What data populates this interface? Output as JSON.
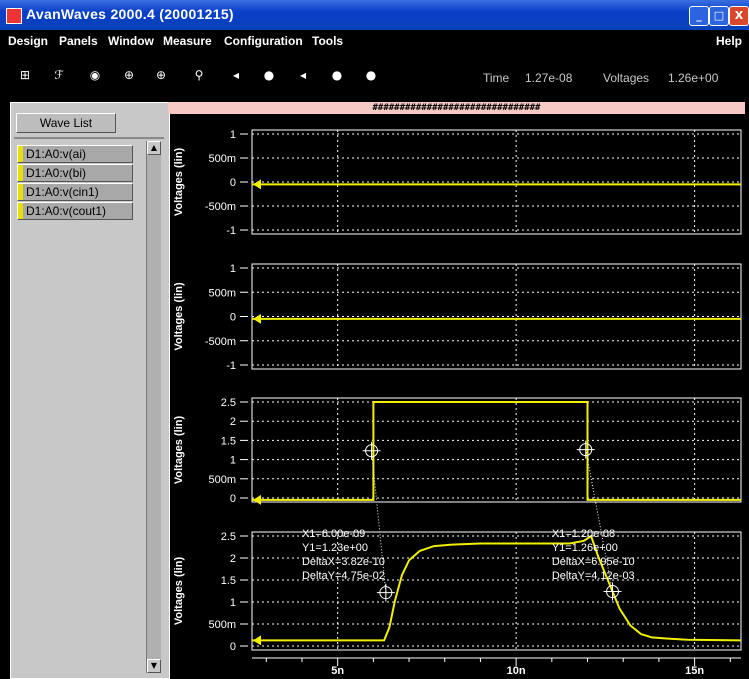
{
  "window": {
    "title": "AvanWaves 2000.4  (20001215)",
    "buttons": [
      "_",
      "□",
      "X"
    ]
  },
  "menu": {
    "items": [
      "Design",
      "Panels",
      "Window",
      "Measure",
      "Configuration",
      "Tools"
    ],
    "help": "Help"
  },
  "toolbar": {
    "icons": [
      "hierarchy-icon",
      "signal-split-icon",
      "cursor-eye-icon",
      "axis-add-icon",
      "zoom-add-icon",
      "magnify-icon",
      "pan-right-icon",
      "zoom-in-icon",
      "pan-left-icon",
      "zoom-out-icon",
      "zoom-fit-icon"
    ],
    "time_label": "Time",
    "time_value": "1.27e-08",
    "voltages_label": "Voltages",
    "voltages_value": "1.26e+00"
  },
  "panel": {
    "wave_list_label": "Wave List",
    "items": [
      "D1:A0:v(ai)",
      "D1:A0:v(bi)",
      "D1:A0:v(cin1)",
      "D1:A0:v(cout1)"
    ],
    "mark_color": "#e8e000"
  },
  "hatch_text": "###############################",
  "chart_data": [
    {
      "type": "line",
      "ylabel": "Voltages (lin)",
      "yticks": [
        "1",
        "500m",
        "0",
        "-500m",
        "-1"
      ],
      "ylim": [
        -1,
        1
      ],
      "series": [
        {
          "x": [
            2.6,
            16.3
          ],
          "y": [
            -0.05,
            -0.05
          ]
        }
      ]
    },
    {
      "type": "line",
      "ylabel": "Voltages (lin)",
      "yticks": [
        "1",
        "500m",
        "0",
        "-500m",
        "-1"
      ],
      "ylim": [
        -1,
        1
      ],
      "series": [
        {
          "x": [
            2.6,
            16.3
          ],
          "y": [
            -0.05,
            -0.05
          ]
        }
      ]
    },
    {
      "type": "line",
      "ylabel": "Voltages (lin)",
      "yticks": [
        "2.5",
        "2",
        "1.5",
        "1",
        "500m",
        "0"
      ],
      "ylim": [
        0,
        2.5
      ],
      "series": [
        {
          "x": [
            2.6,
            6.0,
            6.0,
            12.0,
            12.0,
            16.3
          ],
          "y": [
            -0.05,
            -0.05,
            2.5,
            2.5,
            -0.05,
            -0.05
          ]
        }
      ],
      "markers": [
        {
          "x": 5.95,
          "y": 1.23
        },
        {
          "x": 11.95,
          "y": 1.26
        }
      ]
    },
    {
      "type": "line",
      "ylabel": "Voltages (lin)",
      "yticks": [
        "2.5",
        "2",
        "1.5",
        "1",
        "500m",
        "0"
      ],
      "ylim": [
        -0.2,
        2.75
      ],
      "xticks": [
        "5n",
        "10n",
        "15n"
      ],
      "xtick_values": [
        5,
        10,
        15
      ],
      "xlim": [
        2.6,
        16.3
      ],
      "series": [
        {
          "x": [
            2.6,
            6.3,
            6.45,
            6.6,
            6.8,
            7.0,
            7.3,
            7.7,
            8.2,
            9.0,
            11.5,
            11.9,
            12.1,
            12.3,
            12.6,
            12.9,
            13.2,
            13.5,
            13.8,
            14.2,
            14.8,
            16.3
          ],
          "y": [
            -0.05,
            -0.05,
            0.3,
            1.0,
            1.7,
            2.1,
            2.35,
            2.48,
            2.52,
            2.55,
            2.55,
            2.62,
            2.75,
            2.2,
            1.5,
            0.8,
            0.35,
            0.12,
            0.03,
            0.0,
            -0.03,
            -0.05
          ]
        }
      ],
      "markers": [
        {
          "x": 6.35,
          "y": 1.23
        },
        {
          "x": 12.7,
          "y": 1.26
        }
      ],
      "annotations": [
        [
          "X1=6.00e-09",
          "Y1=1.23e+00",
          "DeltaX=3.82e-10",
          "DeltaY=4.75e-02"
        ],
        [
          "X1=1.20e-08",
          "Y1=1.26e+00",
          "DeltaX=6.95e-10",
          "DeltaY=4.12e-03"
        ]
      ]
    }
  ],
  "colors": {
    "trace": "#f0f000",
    "grid": "#ffffff",
    "background": "#000000"
  }
}
